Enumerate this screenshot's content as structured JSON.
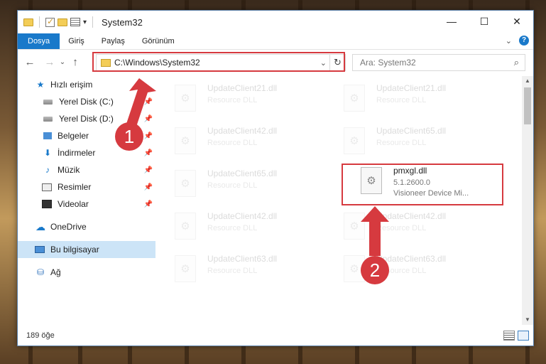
{
  "window": {
    "title": "System32",
    "controls": {
      "minimize": "—",
      "maximize": "☐",
      "close": "✕"
    }
  },
  "ribbon": {
    "tabs": [
      {
        "label": "Dosya"
      },
      {
        "label": "Giriş"
      },
      {
        "label": "Paylaş"
      },
      {
        "label": "Görünüm"
      }
    ],
    "help": "?"
  },
  "navigation": {
    "back": "←",
    "forward": "→",
    "up": "↑",
    "address": "C:\\Windows\\System32",
    "search_placeholder": "Ara: System32"
  },
  "sidebar": {
    "items": [
      {
        "label": "Hızlı erişim",
        "icon": "star-icon",
        "pinned": false
      },
      {
        "label": "Yerel Disk (C:)",
        "icon": "drive-icon",
        "pinned": true
      },
      {
        "label": "Yerel Disk (D:)",
        "icon": "drive-icon",
        "pinned": true
      },
      {
        "label": "Belgeler",
        "icon": "desktop-icon",
        "pinned": true
      },
      {
        "label": "İndirmeler",
        "icon": "download-icon",
        "pinned": true
      },
      {
        "label": "Müzik",
        "icon": "music-icon",
        "pinned": true
      },
      {
        "label": "Resimler",
        "icon": "pictures-icon",
        "pinned": true
      },
      {
        "label": "Videolar",
        "icon": "video-icon",
        "pinned": true
      },
      {
        "label": "OneDrive",
        "icon": "cloud-icon",
        "pinned": false
      },
      {
        "label": "Bu bilgisayar",
        "icon": "computer-icon",
        "pinned": false,
        "selected": true
      },
      {
        "label": "Ağ",
        "icon": "network-icon",
        "pinned": false
      }
    ]
  },
  "files": [
    {
      "name": "UpdateClient21.dll",
      "desc": "Resource DLL",
      "faded": true
    },
    {
      "name": "UpdateClient21.dll",
      "desc": "Resource DLL",
      "faded": true
    },
    {
      "name": "UpdateClient42.dll",
      "desc": "Resource DLL",
      "faded": true
    },
    {
      "name": "UpdateClient65.dll",
      "desc": "Resource DLL",
      "faded": true
    },
    {
      "name": "UpdateClient65.dll",
      "desc": "Resource DLL",
      "faded": true
    },
    {
      "name": "pmxgl.dll",
      "version": "5.1.2600.0",
      "desc": "Visioneer Device Mi...",
      "faded": false,
      "highlighted": true
    },
    {
      "name": "UpdateClient42.dll",
      "desc": "Resource DLL",
      "faded": true
    },
    {
      "name": "UpdateClient42.dll",
      "desc": "Resource DLL",
      "faded": true
    },
    {
      "name": "UpdateClient63.dll",
      "desc": "Resource DLL",
      "faded": true
    },
    {
      "name": "UpdateClient63.dll",
      "desc": "Resource DLL",
      "faded": true
    }
  ],
  "status": {
    "count": "189 öğe"
  },
  "annotations": [
    {
      "label": "1",
      "color": "#d63a3f"
    },
    {
      "label": "2",
      "color": "#d63a3f"
    }
  ]
}
